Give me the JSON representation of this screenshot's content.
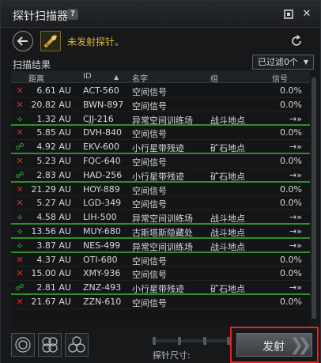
{
  "window": {
    "title": "探针扫描器",
    "help_icon": "?",
    "pin_icon": "pin-icon",
    "close_icon": "close-icon"
  },
  "toolbar": {
    "status": "未发射探针。"
  },
  "results": {
    "label": "扫描结果",
    "filter": "已过滤0个"
  },
  "columns": {
    "dist": "距离",
    "id": "ID",
    "name": "名字",
    "group": "组",
    "signal": "信号"
  },
  "rows": [
    {
      "icon": "✕",
      "type": "x",
      "dist": "6.61 AU",
      "id": "ACT-560",
      "name": "空间信号",
      "group": "",
      "signal": "0.0%"
    },
    {
      "icon": "✕",
      "type": "x",
      "dist": "20.82 AU",
      "id": "BWN-897",
      "name": "空间信号",
      "group": "",
      "signal": "0.0%"
    },
    {
      "icon": "⟡",
      "type": "g",
      "dist": "1.32 AU",
      "id": "CJJ-216",
      "name": "异常空间训练场",
      "group": "战斗地点",
      "signal": "→»",
      "hl": true
    },
    {
      "icon": "✕",
      "type": "x",
      "dist": "5.85 AU",
      "id": "DVH-840",
      "name": "空间信号",
      "group": "",
      "signal": "0.0%"
    },
    {
      "icon": "☍",
      "type": "g",
      "dist": "4.92 AU",
      "id": "EKV-600",
      "name": "小行星带残迹",
      "group": "矿石地点",
      "signal": "→»",
      "hl": true
    },
    {
      "icon": "✕",
      "type": "x",
      "dist": "5.23 AU",
      "id": "FQC-640",
      "name": "空间信号",
      "group": "",
      "signal": "0.0%"
    },
    {
      "icon": "☍",
      "type": "g",
      "dist": "2.83 AU",
      "id": "HAD-256",
      "name": "小行星带残迹",
      "group": "矿石地点",
      "signal": "→»",
      "hl": true
    },
    {
      "icon": "✕",
      "type": "x",
      "dist": "21.29 AU",
      "id": "HOY-889",
      "name": "空间信号",
      "group": "",
      "signal": "0.0%"
    },
    {
      "icon": "✕",
      "type": "x",
      "dist": "5.27 AU",
      "id": "LGD-349",
      "name": "空间信号",
      "group": "",
      "signal": "0.0%"
    },
    {
      "icon": "⟡",
      "type": "g",
      "dist": "4.58 AU",
      "id": "LIH-500",
      "name": "异常空间训练场",
      "group": "战斗地点",
      "signal": "→»",
      "hl": true
    },
    {
      "icon": "⟡",
      "type": "g",
      "dist": "13.56 AU",
      "id": "MUY-680",
      "name": "古斯塔斯隐藏处",
      "group": "战斗地点",
      "signal": "→»",
      "hl": true
    },
    {
      "icon": "⟡",
      "type": "g",
      "dist": "3.87 AU",
      "id": "NES-499",
      "name": "异常空间训练场",
      "group": "战斗地点",
      "signal": "→»",
      "hl": true
    },
    {
      "icon": "✕",
      "type": "x",
      "dist": "4.37 AU",
      "id": "OTI-680",
      "name": "空间信号",
      "group": "",
      "signal": "0.0%"
    },
    {
      "icon": "✕",
      "type": "x",
      "dist": "15.00 AU",
      "id": "XMY-936",
      "name": "空间信号",
      "group": "",
      "signal": "0.0%"
    },
    {
      "icon": "☍",
      "type": "g",
      "dist": "2.81 AU",
      "id": "ZNZ-493",
      "name": "小行星带残迹",
      "group": "矿石地点",
      "signal": "→»",
      "hl": true
    },
    {
      "icon": "✕",
      "type": "x",
      "dist": "21.67 AU",
      "id": "ZZN-610",
      "name": "空间信号",
      "group": "",
      "signal": "0.0%"
    }
  ],
  "bottom": {
    "size_label": "探针尺寸:",
    "launch": "发射"
  }
}
